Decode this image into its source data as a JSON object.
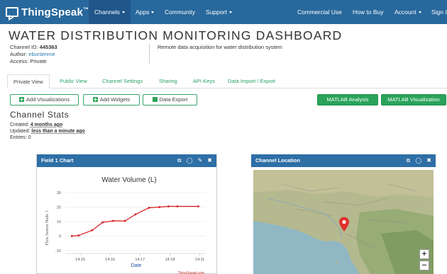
{
  "navbar": {
    "brand": "ThingSpeak",
    "brand_mark": "™",
    "items": [
      {
        "label": "Channels",
        "dropdown": true
      },
      {
        "label": "Apps",
        "dropdown": true
      },
      {
        "label": "Community",
        "dropdown": false
      },
      {
        "label": "Support",
        "dropdown": true
      },
      {
        "label": "Commercial Use",
        "dropdown": false
      },
      {
        "label": "How to Buy",
        "dropdown": false
      },
      {
        "label": "Account",
        "dropdown": true
      },
      {
        "label": "Sign O",
        "dropdown": false
      }
    ]
  },
  "header": {
    "title": "WATER DISTRIBUTION MONITORING DASHBOARD",
    "channel_id_label": "Channel ID:",
    "channel_id": "445363",
    "author_label": "Author:",
    "author": "ebunlerene",
    "access_label": "Access:",
    "access": "Private",
    "description": "Remote data acquisition for water distribution system"
  },
  "tabs": [
    {
      "label": "Private View",
      "active": true
    },
    {
      "label": "Public View",
      "active": false
    },
    {
      "label": "Channel Settings",
      "active": false
    },
    {
      "label": "Sharing",
      "active": false
    },
    {
      "label": "API Keys",
      "active": false
    },
    {
      "label": "Data Import / Export",
      "active": false
    }
  ],
  "actions": {
    "add_visualizations": "Add Visualizations",
    "add_widgets": "Add Widgets",
    "data_export": "Data Export",
    "matlab_analysis": "MATLAB Analysis",
    "matlab_visualization": "MATLAB Visualization"
  },
  "stats": {
    "title": "Channel Stats",
    "created_label": "Created:",
    "created": "4 months ago",
    "updated_label": "Updated:",
    "updated": "less than a minute ago",
    "entries_label": "Entries:",
    "entries": "0"
  },
  "field_chart": {
    "panel_title": "Field 1 Chart",
    "credit": "ThingSpeak.com"
  },
  "location": {
    "panel_title": "Channel Location",
    "zoom_in": "+",
    "zoom_out": "−"
  },
  "colors": {
    "navbar": "#28689c",
    "panel_header": "#2e6fa6",
    "accent_green": "#29a35a",
    "series": "#d7191c"
  },
  "chart_data": {
    "type": "line",
    "title": "Water Volume (L)",
    "xlabel": "Date",
    "ylabel": "Flow Sensor Node 1",
    "x_ticks": [
      "14:15",
      "14:16",
      "14:17",
      "14:18",
      "14:11"
    ],
    "y_ticks": [
      -10,
      0,
      10,
      20,
      30
    ],
    "ylim": [
      -10,
      30
    ],
    "grid": true,
    "series": [
      {
        "name": "",
        "x": [
          14.72,
          14.95,
          15.4,
          15.75,
          16.1,
          16.5,
          16.85,
          17.3,
          17.65,
          17.95,
          18.25,
          18.95
        ],
        "values": [
          0,
          0.5,
          4,
          9.5,
          10.5,
          10.5,
          15,
          19.5,
          20,
          20.5,
          20.5,
          20.5
        ]
      }
    ]
  }
}
